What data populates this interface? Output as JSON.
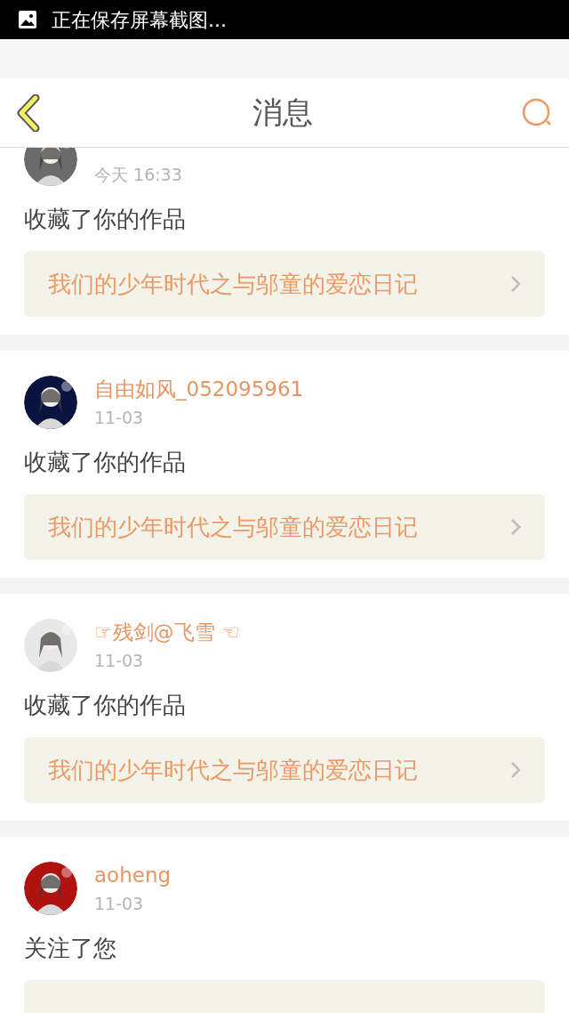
{
  "status_bar": {
    "notification": "正在保存屏幕截图..."
  },
  "header": {
    "title": "消息"
  },
  "messages": [
    {
      "time": "今天 16:33",
      "action": "收藏了你的作品",
      "link": "我们的少年时代之与邬童的爱恋日记"
    },
    {
      "name": "自由如风_052095961",
      "time": "11-03",
      "action": "收藏了你的作品",
      "link": "我们的少年时代之与邬童的爱恋日记"
    },
    {
      "name": "☞残剑@飞雪 ☜",
      "time": "11-03",
      "action": "收藏了你的作品",
      "link": "我们的少年时代之与邬童的爱恋日记"
    },
    {
      "name": "aoheng",
      "time": "11-03",
      "action": "关注了您"
    }
  ]
}
